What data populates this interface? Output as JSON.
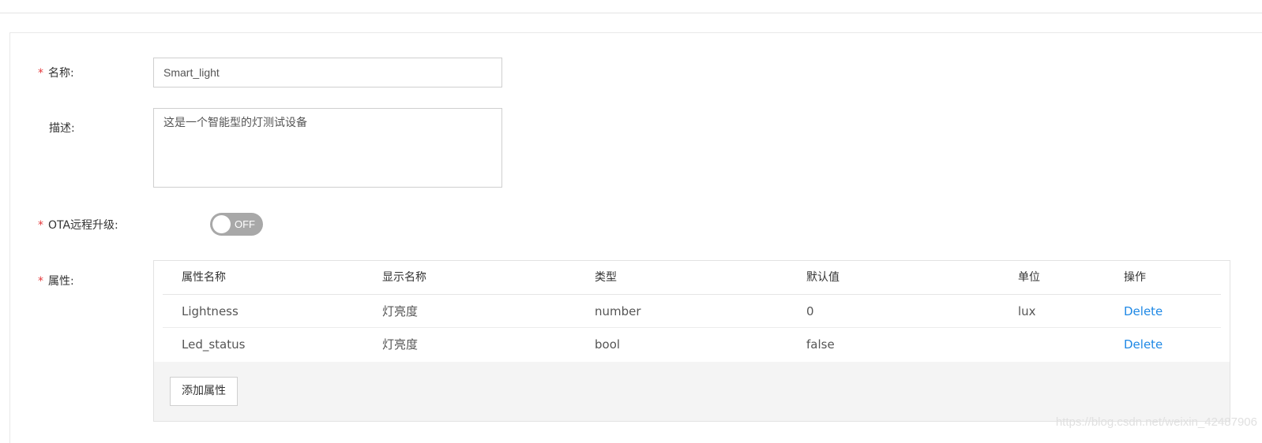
{
  "form": {
    "name": {
      "required": "*",
      "label": "名称:",
      "value": "Smart_light"
    },
    "description": {
      "label": "描述:",
      "value": "这是一个智能型的灯测试设备"
    },
    "ota": {
      "required": "*",
      "label": "OTA远程升级:",
      "toggle_state": "OFF",
      "enabled": false
    },
    "attributes": {
      "required": "*",
      "label": "属性:",
      "columns": [
        "属性名称",
        "显示名称",
        "类型",
        "默认值",
        "单位",
        "操作"
      ],
      "rows": [
        {
          "name": "Lightness",
          "display": "灯亮度",
          "type": "number",
          "default": "0",
          "unit": "lux",
          "action": "Delete"
        },
        {
          "name": "Led_status",
          "display": "灯亮度",
          "type": "bool",
          "default": "false",
          "unit": "",
          "action": "Delete"
        }
      ],
      "add_button": "添加属性"
    }
  },
  "watermark": "https://blog.csdn.net/weixin_42487906",
  "colors": {
    "required": "#e4393c",
    "link": "#1e88e5",
    "toggle_off": "#a8a8a8"
  }
}
